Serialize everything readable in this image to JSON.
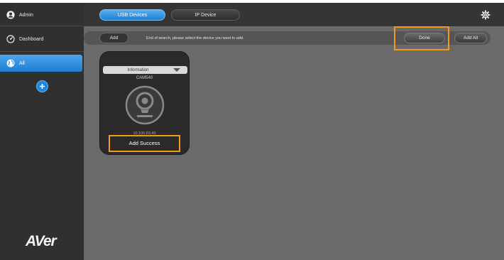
{
  "sidebar": {
    "user_label": "Admin",
    "dashboard_label": "Dashboard",
    "all_label": "All",
    "logo_text": "AVer"
  },
  "topbar": {
    "tabs": [
      {
        "label": "USB Devices",
        "active": true
      },
      {
        "label": "IP Device",
        "active": false
      }
    ]
  },
  "actionbar": {
    "add_label": "Add",
    "message": "End of search, please select the device you want to add.",
    "done_label": "Done",
    "add_all_label": "Add All"
  },
  "device_card": {
    "dropdown_label": "Information",
    "device_name": "CAM540",
    "ip_address": "10.100.83.45",
    "status": "Add Success"
  },
  "colors": {
    "accent": "#1f86dd",
    "highlight": "#f39a1d",
    "background": "#6a6a6a",
    "sidebar": "#303030"
  }
}
